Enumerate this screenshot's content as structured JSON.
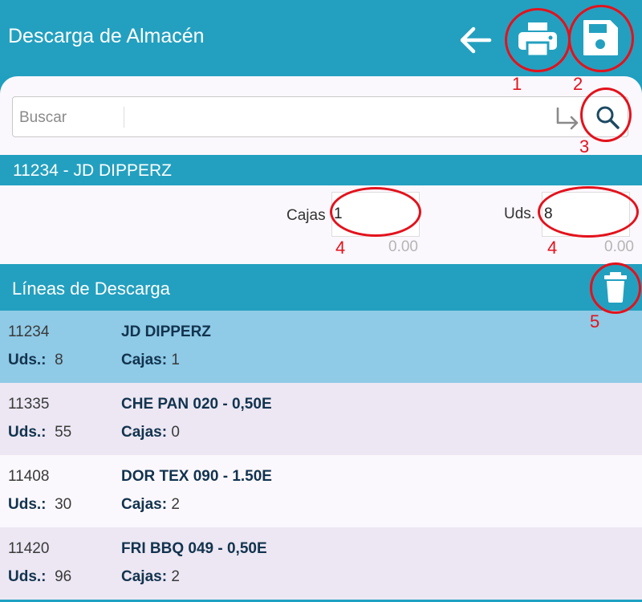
{
  "header": {
    "title": "Descarga de Almacén",
    "icons": [
      "back-arrow-icon",
      "printer-icon",
      "save-disk-icon"
    ]
  },
  "search": {
    "label": "Buscar",
    "value": "",
    "icons": [
      "enter-arrow-icon",
      "search-icon"
    ]
  },
  "product": {
    "title": "11234 - JD DIPPERZ",
    "cajas_label": "Cajas",
    "cajas_value": "1",
    "cajas_total": "0.00",
    "uds_label": "Uds.",
    "uds_value": "8",
    "uds_total": "0.00"
  },
  "lines": {
    "title": "Líneas de Descarga",
    "delete_icon": "trash-icon",
    "uds_label": "Uds.:",
    "cajas_label": "Cajas:",
    "items": [
      {
        "code": "11234",
        "desc": "JD DIPPERZ",
        "uds": "8",
        "cajas": "1",
        "selected": true
      },
      {
        "code": "11335",
        "desc": "CHE PAN 020 - 0,50E",
        "uds": "55",
        "cajas": "0"
      },
      {
        "code": "11408",
        "desc": "DOR TEX 090 - 1.50E",
        "uds": "30",
        "cajas": "2"
      },
      {
        "code": "11420",
        "desc": "FRI BBQ 049 - 0,50E",
        "uds": "96",
        "cajas": "2"
      }
    ]
  },
  "annotations": {
    "labels": [
      "1",
      "2",
      "3",
      "4",
      "4",
      "5"
    ],
    "color": "#e3121c"
  },
  "colors": {
    "primary": "#23a0c0",
    "selected_row": "#8fcae6",
    "alt_row": "#ece7f3",
    "text_dark": "#12334e"
  }
}
